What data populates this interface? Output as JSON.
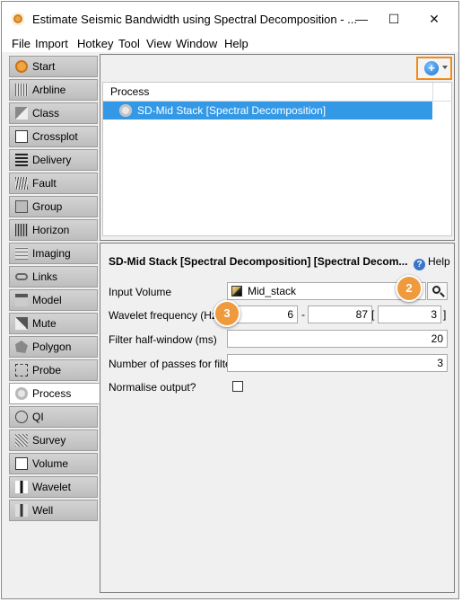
{
  "window": {
    "title": "Estimate Seismic Bandwidth using Spectral Decomposition - ...",
    "minimize": "—",
    "maximize": "☐",
    "close": "✕"
  },
  "menu": [
    "File",
    "Import",
    "Hotkey",
    "Tool",
    "View",
    "Window",
    "Help"
  ],
  "sidebar": {
    "items": [
      {
        "label": "Start",
        "icon": "start-icon"
      },
      {
        "label": "Arbline",
        "icon": "arbline-icon"
      },
      {
        "label": "Class",
        "icon": "class-icon"
      },
      {
        "label": "Crossplot",
        "icon": "crossplot-icon"
      },
      {
        "label": "Delivery",
        "icon": "delivery-icon"
      },
      {
        "label": "Fault",
        "icon": "fault-icon"
      },
      {
        "label": "Group",
        "icon": "group-icon"
      },
      {
        "label": "Horizon",
        "icon": "horizon-icon"
      },
      {
        "label": "Imaging",
        "icon": "imaging-icon"
      },
      {
        "label": "Links",
        "icon": "links-icon"
      },
      {
        "label": "Model",
        "icon": "model-icon"
      },
      {
        "label": "Mute",
        "icon": "mute-icon"
      },
      {
        "label": "Polygon",
        "icon": "polygon-icon"
      },
      {
        "label": "Probe",
        "icon": "probe-icon"
      },
      {
        "label": "Process",
        "icon": "process-icon",
        "active": true
      },
      {
        "label": "QI",
        "icon": "qi-icon"
      },
      {
        "label": "Survey",
        "icon": "survey-icon"
      },
      {
        "label": "Volume",
        "icon": "volume-icon"
      },
      {
        "label": "Wavelet",
        "icon": "wavelet-icon"
      },
      {
        "label": "Well",
        "icon": "well-icon"
      }
    ]
  },
  "process_panel": {
    "add_button_icon": "plus-circle-icon",
    "header": "Process",
    "rows": [
      "SD-Mid Stack [Spectral Decomposition]"
    ]
  },
  "details": {
    "title": "SD-Mid Stack [Spectral Decomposition] [Spectral Decom...",
    "help_label": "Help",
    "input_volume": {
      "label": "Input Volume",
      "value": "Mid_stack"
    },
    "wavelet_frequency": {
      "label": "Wavelet frequency (Hz)",
      "min": "6",
      "dash": "-",
      "max": "87",
      "open_bracket": "[",
      "step": "3",
      "close_bracket": "]"
    },
    "filter_half_window": {
      "label": "Filter half-window (ms)",
      "value": "20"
    },
    "passes": {
      "label": "Number of passes for filter",
      "value": "3"
    },
    "normalise": {
      "label": "Normalise output?",
      "checked": false
    }
  },
  "callouts": [
    "2",
    "3"
  ],
  "colors": {
    "accent_orange": "#f28a1a",
    "selection_blue": "#3399e6",
    "callout": "#f09a3e"
  }
}
